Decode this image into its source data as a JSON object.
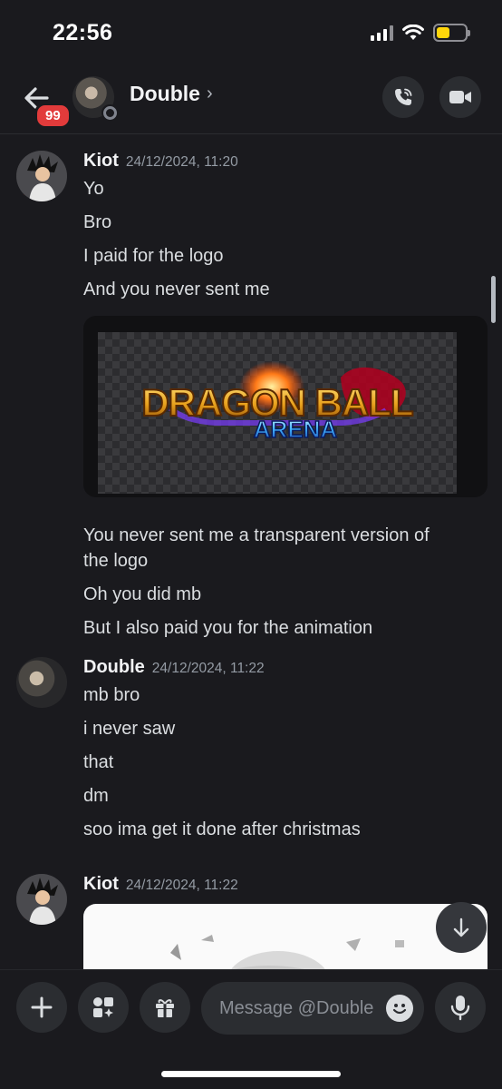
{
  "status_bar": {
    "time": "22:56",
    "battery_color": "#ffd60a",
    "battery_level": 0.45
  },
  "header": {
    "unread_badge": "99",
    "name": "Double",
    "chevron": "›",
    "icons": {
      "back": "arrow-left-icon",
      "call": "phone-call-icon",
      "video": "video-camera-icon"
    }
  },
  "messages": [
    {
      "author": "Kiot",
      "timestamp": "24/12/2024, 11:20",
      "lines": [
        "Yo",
        "Bro",
        "I paid for the logo",
        "And you never sent me"
      ],
      "attachment": {
        "logo_line1": "DRAGON BALL",
        "logo_line2": "ARENA"
      },
      "lines_after": [
        "You never sent me a transparent version of",
        "the logo",
        "Oh you did mb",
        "But I also paid you for the animation"
      ]
    },
    {
      "author": "Double",
      "timestamp": "24/12/2024, 11:22",
      "lines": [
        "mb bro",
        "i never saw",
        "that",
        "dm",
        "soo ima get it done after christmas"
      ]
    },
    {
      "author": "Kiot",
      "timestamp": "24/12/2024, 11:22"
    }
  ],
  "composer": {
    "placeholder": "Message @Double",
    "icons": {
      "add": "plus-icon",
      "apps": "apps-icon",
      "gift": "gift-icon",
      "emoji": "emoji-icon",
      "mic": "microphone-icon"
    }
  },
  "colors": {
    "background": "#1a1a1e",
    "badge": "#e23b3b",
    "button": "#2b2d31"
  }
}
